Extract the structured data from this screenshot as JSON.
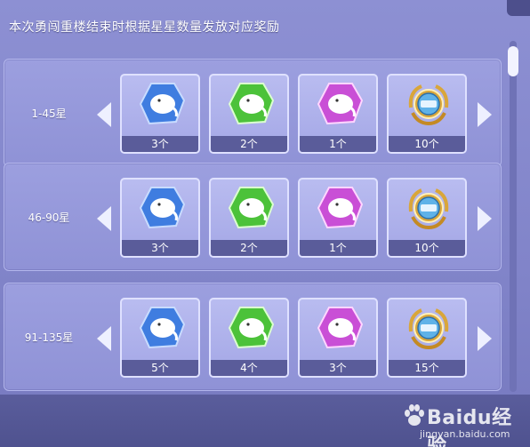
{
  "title": "本次勇闯重楼结束时根据星星数量发放对应奖励",
  "tiers": [
    {
      "range": "1-45星",
      "rewards": [
        {
          "icon": "blue-whale-gem-icon",
          "count": "3个"
        },
        {
          "icon": "green-whale-gem-icon",
          "count": "2个"
        },
        {
          "icon": "pink-whale-gem-icon",
          "count": "1个"
        },
        {
          "icon": "gold-medal-icon",
          "count": "10个"
        }
      ]
    },
    {
      "range": "46-90星",
      "rewards": [
        {
          "icon": "blue-whale-gem-icon",
          "count": "3个"
        },
        {
          "icon": "green-whale-gem-icon",
          "count": "2个"
        },
        {
          "icon": "pink-whale-gem-icon",
          "count": "1个"
        },
        {
          "icon": "gold-medal-icon",
          "count": "10个"
        }
      ]
    },
    {
      "range": "91-135星",
      "rewards": [
        {
          "icon": "blue-whale-gem-icon",
          "count": "5个"
        },
        {
          "icon": "green-whale-gem-icon",
          "count": "4个"
        },
        {
          "icon": "pink-whale-gem-icon",
          "count": "3个"
        },
        {
          "icon": "gold-medal-icon",
          "count": "15个"
        }
      ]
    }
  ],
  "watermark": {
    "brand": "Baidu经验",
    "url": "jingyan.baidu.com"
  },
  "colors": {
    "blue_gem": "#3f7de0",
    "green_gem": "#4cc23a",
    "pink_gem": "#c94fd6",
    "gold_medal": "#d9a63a",
    "panel": "#8a8dd0"
  }
}
